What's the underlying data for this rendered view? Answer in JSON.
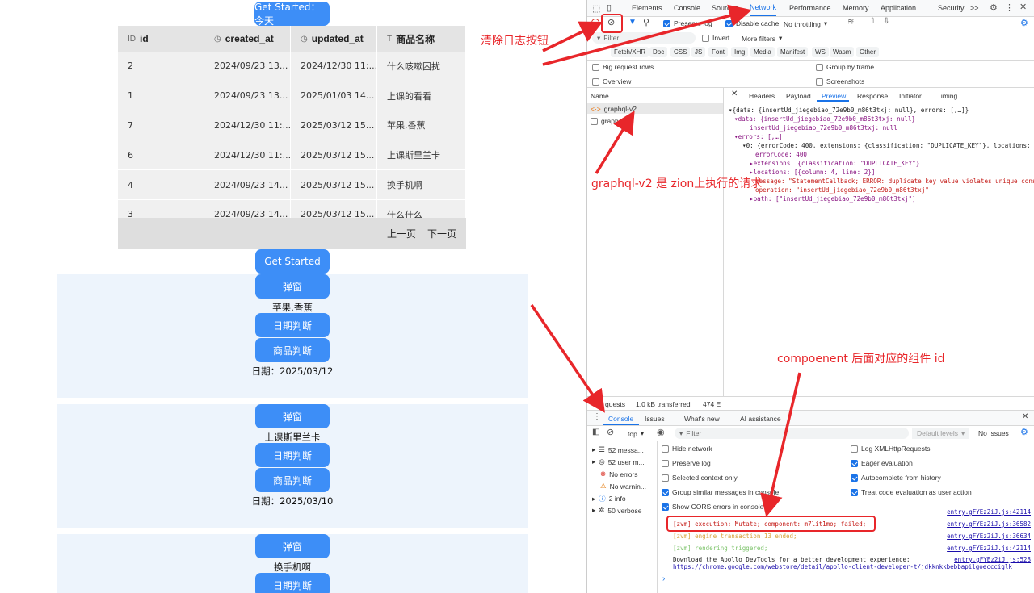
{
  "app": {
    "get_started_today": "Get Started：今天",
    "table": {
      "headers": [
        {
          "icon": "ID",
          "label": "id"
        },
        {
          "icon": "clock-icon",
          "label": "created_at"
        },
        {
          "icon": "clock-icon",
          "label": "updated_at"
        },
        {
          "icon": "T",
          "label": "商品名称"
        }
      ],
      "rows": [
        [
          "2",
          "2024/09/23 13...",
          "2024/12/30 11:...",
          "什么咳嗽困扰"
        ],
        [
          "1",
          "2024/09/23 13...",
          "2025/01/03 14...",
          "上课的看看"
        ],
        [
          "7",
          "2024/12/30 11:...",
          "2025/03/12 15...",
          "苹果,香蕉"
        ],
        [
          "6",
          "2024/12/30 11:...",
          "2025/03/12 15...",
          "上课斯里兰卡"
        ],
        [
          "4",
          "2024/09/23 14...",
          "2025/03/12 15...",
          "换手机啊"
        ],
        [
          "3",
          "2024/09/23 14...",
          "2025/03/12 15...",
          "什么什么"
        ]
      ],
      "prev": "上一页",
      "next": "下一页"
    },
    "get_started": "Get Started",
    "popup": "弹窗",
    "date_check": "日期判断",
    "product_check": "商品判断",
    "card1_product": "苹果,香蕉",
    "card1_date": "日期：2025/03/12",
    "card2_product": "上课斯里兰卡",
    "card2_date": "日期：2025/03/10",
    "card3_product": "换手机啊"
  },
  "devtools": {
    "tabs": [
      "Elements",
      "Console",
      "Sources",
      "Network",
      "Performance",
      "Memory",
      "Application",
      "Security"
    ],
    "active_tab": "Network",
    "more_tabs": ">>",
    "preserve_log": "Preserve log",
    "disable_cache": "Disable cache",
    "throttling": "No throttling",
    "filter_placeholder": "Filter",
    "invert": "Invert",
    "more_filters": "More filters",
    "type_filters": [
      "Fetch/XHR",
      "Doc",
      "CSS",
      "JS",
      "Font",
      "Img",
      "Media",
      "Manifest",
      "WS",
      "Wasm",
      "Other"
    ],
    "big_request_rows": "Big request rows",
    "group_by_frame": "Group by frame",
    "overview": "Overview",
    "screenshots": "Screenshots",
    "name_col": "Name",
    "requests": [
      {
        "icon": "<·>",
        "name": "graphql-v2"
      },
      {
        "icon": "",
        "name": "graphq"
      }
    ],
    "detail_tabs": [
      "Headers",
      "Payload",
      "Preview",
      "Response",
      "Initiator",
      "Timing"
    ],
    "active_detail_tab": "Preview",
    "preview": [
      "▾{data: {insertUd_jiegebiao_72e9b0_m86t3txj: null}, errors: [,…]}",
      "▾data: {insertUd_jiegebiao_72e9b0_m86t3txj: null}",
      "insertUd_jiegebiao_72e9b0_m86t3txj: null",
      "▾errors: [,…]",
      "▾0: {errorCode: 400, extensions: {classification: \"DUPLICATE_KEY\"}, locations:",
      "errorCode: 400",
      "▸extensions: {classification: \"DUPLICATE_KEY\"}",
      "▸locations: [{column: 4, line: 2}]",
      "message: \"StatementCallback; ERROR: duplicate key value violates unique cons",
      "operation: \"insertUd_jiegebiao_72e9b0_m86t3txj\"",
      "▸path: [\"insertUd_jiegebiao_72e9b0_m86t3txj\"]"
    ],
    "status_requests": "quests",
    "status_transferred": "1.0 kB transferred",
    "status_resources": "474 E",
    "console_tabs": [
      "Console",
      "Issues",
      "What's new",
      "AI assistance"
    ],
    "context": "top",
    "console_filter": "Filter",
    "default_levels": "Default levels",
    "no_issues": "No Issues",
    "sidebar": [
      {
        "icon": "list-icon",
        "label": "52 messa..."
      },
      {
        "icon": "user-icon",
        "label": "52 user m..."
      },
      {
        "icon": "error-icon",
        "label": "No errors"
      },
      {
        "icon": "warning-icon",
        "label": "No warnin..."
      },
      {
        "icon": "info-icon",
        "label": "2 info"
      },
      {
        "icon": "bug-icon",
        "label": "50 verbose"
      }
    ],
    "settings_left": [
      {
        "label": "Hide network",
        "on": false
      },
      {
        "label": "Preserve log",
        "on": false
      },
      {
        "label": "Selected context only",
        "on": false
      },
      {
        "label": "Group similar messages in console",
        "on": true
      },
      {
        "label": "Show CORS errors in console",
        "on": true
      }
    ],
    "settings_right": [
      {
        "label": "Log XMLHttpRequests",
        "on": false
      },
      {
        "label": "Eager evaluation",
        "on": true
      },
      {
        "label": "Autocomplete from history",
        "on": true
      },
      {
        "label": "Treat code evaluation as user action",
        "on": true
      }
    ],
    "logs": [
      {
        "text": "[zvm] execution: Mutate; component: m7lit1mo; failed;",
        "src": "entry.gFYEz2iJ.js:36582",
        "color": "#c41a16"
      },
      {
        "text": "[zvm] engine transaction 13 ended;",
        "src": "entry.gFYEz2iJ.js:36634",
        "color": "#d9a23a"
      },
      {
        "text": "[zvm] rendering triggered;",
        "src": "entry.gFYEz2iJ.js:42114",
        "color": "#7cc36a"
      },
      {
        "text": "Download the Apollo DevTools for a better development experience:",
        "src": "entry.gFYEz2iJ.js:528",
        "color": "#222"
      },
      {
        "text": "https://chrome.google.com/webstore/detail/apollo-client-developer-t/jdkknkkbebbapilgoeccciglk",
        "src": "",
        "color": "#1a0dab"
      }
    ],
    "log_hidden_src": "entry.gFYEz2iJ.js:42114",
    "prompt": "›"
  },
  "annotations": {
    "clear_log": "清除日志按钮",
    "graphql_note": "graphql-v2 是 zion上执行的请求",
    "component_note": "compoenent 后面对应的组件 id"
  },
  "colors": {
    "accent": "#3d8ef7",
    "annotation": "#e8262a",
    "devtools_blue": "#1a73e8"
  }
}
